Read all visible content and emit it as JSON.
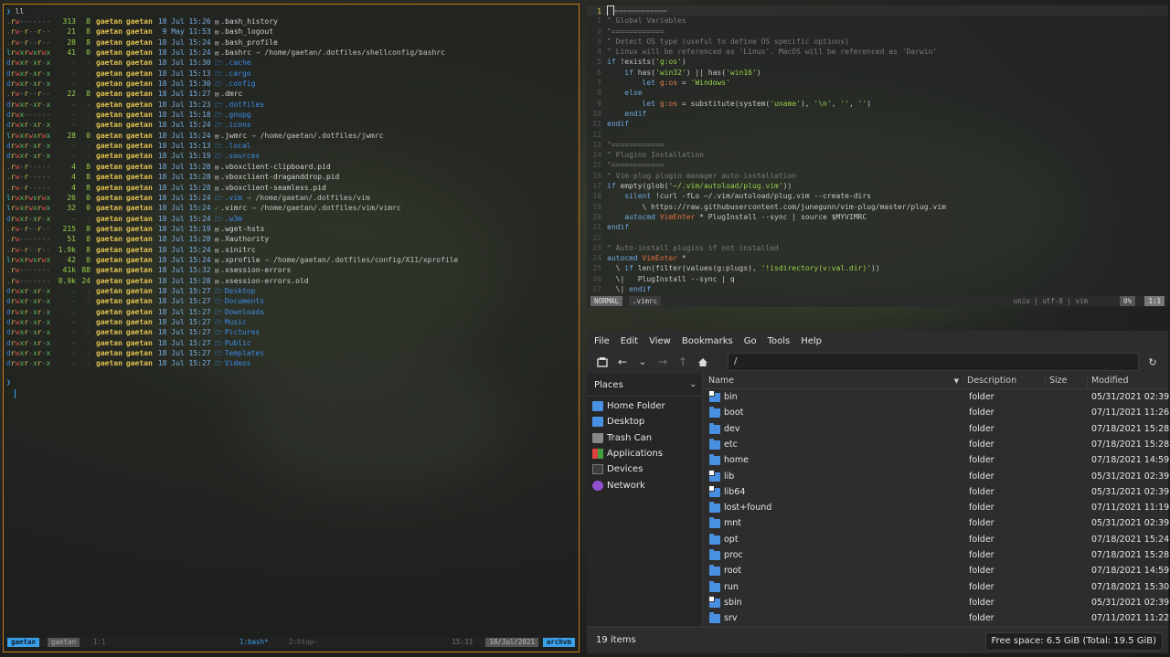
{
  "terminal": {
    "prompt_glyph": "❯",
    "command": "ll",
    "rows": [
      {
        "perm": ".rw-------",
        "size": "313",
        "blk": "8",
        "user": "gaetan",
        "group": "gaetan",
        "date": "18 Jul 15:26",
        "icon": "file",
        "name": ".bash_history",
        "link": ""
      },
      {
        "perm": ".rw-r--r--",
        "size": "21",
        "blk": "8",
        "user": "gaetan",
        "group": "gaetan",
        "date": " 9 May 11:53",
        "icon": "file",
        "name": ".bash_logout",
        "link": ""
      },
      {
        "perm": ".rw-r--r--",
        "size": "28",
        "blk": "8",
        "user": "gaetan",
        "group": "gaetan",
        "date": "18 Jul 15:24",
        "icon": "file",
        "name": ".bash_profile",
        "link": ""
      },
      {
        "perm": "lrwxrwxrwx",
        "size": "41",
        "blk": "0",
        "user": "gaetan",
        "group": "gaetan",
        "date": "18 Jul 15:24",
        "icon": "file",
        "name": ".bashrc",
        "link": "/home/gaetan/.dotfiles/shellconfig/bashrc"
      },
      {
        "perm": "drwxr-xr-x",
        "size": "-",
        "blk": "-",
        "user": "gaetan",
        "group": "gaetan",
        "date": "18 Jul 15:30",
        "icon": "dir",
        "name": ".cache",
        "link": ""
      },
      {
        "perm": "drwxr-xr-x",
        "size": "-",
        "blk": "-",
        "user": "gaetan",
        "group": "gaetan",
        "date": "18 Jul 15:13",
        "icon": "dir",
        "name": ".cargo",
        "link": ""
      },
      {
        "perm": "drwxr-xr-x",
        "size": "-",
        "blk": "-",
        "user": "gaetan",
        "group": "gaetan",
        "date": "18 Jul 15:30",
        "icon": "dir",
        "name": ".config",
        "link": ""
      },
      {
        "perm": ".rw-r--r--",
        "size": "22",
        "blk": "8",
        "user": "gaetan",
        "group": "gaetan",
        "date": "18 Jul 15:27",
        "icon": "file",
        "name": ".dmrc",
        "link": ""
      },
      {
        "perm": "drwxr-xr-x",
        "size": "-",
        "blk": "-",
        "user": "gaetan",
        "group": "gaetan",
        "date": "18 Jul 15:23",
        "icon": "dir",
        "name": ".dotfiles",
        "link": ""
      },
      {
        "perm": "drwx------",
        "size": "-",
        "blk": "-",
        "user": "gaetan",
        "group": "gaetan",
        "date": "18 Jul 15:18",
        "icon": "dir",
        "name": ".gnupg",
        "link": ""
      },
      {
        "perm": "drwxr-xr-x",
        "size": "-",
        "blk": "-",
        "user": "gaetan",
        "group": "gaetan",
        "date": "18 Jul 15:24",
        "icon": "dir",
        "name": ".icons",
        "link": ""
      },
      {
        "perm": "lrwxrwxrwx",
        "size": "28",
        "blk": "0",
        "user": "gaetan",
        "group": "gaetan",
        "date": "18 Jul 15:24",
        "icon": "file",
        "name": ".jwmrc",
        "link": "/home/gaetan/.dotfiles/jwmrc"
      },
      {
        "perm": "drwxr-xr-x",
        "size": "-",
        "blk": "-",
        "user": "gaetan",
        "group": "gaetan",
        "date": "18 Jul 15:13",
        "icon": "dir",
        "name": ".local",
        "link": ""
      },
      {
        "perm": "drwxr-xr-x",
        "size": "-",
        "blk": "-",
        "user": "gaetan",
        "group": "gaetan",
        "date": "18 Jul 15:19",
        "icon": "dir",
        "name": ".sources",
        "link": ""
      },
      {
        "perm": ".rw-r-----",
        "size": "4",
        "blk": "8",
        "user": "gaetan",
        "group": "gaetan",
        "date": "18 Jul 15:28",
        "icon": "file",
        "name": ".vboxclient-clipboard.pid",
        "link": ""
      },
      {
        "perm": ".rw-r-----",
        "size": "4",
        "blk": "8",
        "user": "gaetan",
        "group": "gaetan",
        "date": "18 Jul 15:28",
        "icon": "file",
        "name": ".vboxclient-draganddrop.pid",
        "link": ""
      },
      {
        "perm": ".rw-r-----",
        "size": "4",
        "blk": "8",
        "user": "gaetan",
        "group": "gaetan",
        "date": "18 Jul 15:28",
        "icon": "file",
        "name": ".vboxclient-seamless.pid",
        "link": ""
      },
      {
        "perm": "lrwxrwxrwx",
        "size": "26",
        "blk": "0",
        "user": "gaetan",
        "group": "gaetan",
        "date": "18 Jul 15:24",
        "icon": "dir",
        "name": ".vim",
        "link": "/home/gaetan/.dotfiles/vim"
      },
      {
        "perm": "lrwxrwxrwx",
        "size": "32",
        "blk": "0",
        "user": "gaetan",
        "group": "gaetan",
        "date": "18 Jul 15:24",
        "icon": "vim",
        "name": ".vimrc",
        "link": "/home/gaetan/.dotfiles/vim/vimrc"
      },
      {
        "perm": "drwxr-xr-x",
        "size": "-",
        "blk": "-",
        "user": "gaetan",
        "group": "gaetan",
        "date": "18 Jul 15:24",
        "icon": "dir",
        "name": ".w3m",
        "link": ""
      },
      {
        "perm": ".rw-r--r--",
        "size": "215",
        "blk": "8",
        "user": "gaetan",
        "group": "gaetan",
        "date": "18 Jul 15:19",
        "icon": "file",
        "name": ".wget-hsts",
        "link": ""
      },
      {
        "perm": ".rw-------",
        "size": "51",
        "blk": "8",
        "user": "gaetan",
        "group": "gaetan",
        "date": "18 Jul 15:28",
        "icon": "file",
        "name": ".Xauthority",
        "link": ""
      },
      {
        "perm": ".rw-r--r--",
        "size": "1.9k",
        "blk": "8",
        "user": "gaetan",
        "group": "gaetan",
        "date": "18 Jul 15:24",
        "icon": "file",
        "name": ".xinitrc",
        "link": ""
      },
      {
        "perm": "lrwxrwxrwx",
        "size": "42",
        "blk": "0",
        "user": "gaetan",
        "group": "gaetan",
        "date": "18 Jul 15:24",
        "icon": "file",
        "name": ".xprofile",
        "link": "/home/gaetan/.dotfiles/config/X11/xprofile"
      },
      {
        "perm": ".rw-------",
        "size": "41k",
        "blk": "88",
        "user": "gaetan",
        "group": "gaetan",
        "date": "18 Jul 15:32",
        "icon": "file",
        "name": ".xsession-errors",
        "link": ""
      },
      {
        "perm": ".rw-------",
        "size": "8.9k",
        "blk": "24",
        "user": "gaetan",
        "group": "gaetan",
        "date": "18 Jul 15:28",
        "icon": "file",
        "name": ".xsession-errors.old",
        "link": ""
      },
      {
        "perm": "drwxr-xr-x",
        "size": "-",
        "blk": "-",
        "user": "gaetan",
        "group": "gaetan",
        "date": "18 Jul 15:27",
        "icon": "dir",
        "name": "Desktop",
        "link": ""
      },
      {
        "perm": "drwxr-xr-x",
        "size": "-",
        "blk": "-",
        "user": "gaetan",
        "group": "gaetan",
        "date": "18 Jul 15:27",
        "icon": "dir",
        "name": "Documents",
        "link": ""
      },
      {
        "perm": "drwxr-xr-x",
        "size": "-",
        "blk": "-",
        "user": "gaetan",
        "group": "gaetan",
        "date": "18 Jul 15:27",
        "icon": "dir",
        "name": "Downloads",
        "link": ""
      },
      {
        "perm": "drwxr-xr-x",
        "size": "-",
        "blk": "-",
        "user": "gaetan",
        "group": "gaetan",
        "date": "18 Jul 15:27",
        "icon": "dir",
        "name": "Music",
        "link": ""
      },
      {
        "perm": "drwxr-xr-x",
        "size": "-",
        "blk": "-",
        "user": "gaetan",
        "group": "gaetan",
        "date": "18 Jul 15:27",
        "icon": "dir",
        "name": "Pictures",
        "link": ""
      },
      {
        "perm": "drwxr-xr-x",
        "size": "-",
        "blk": "-",
        "user": "gaetan",
        "group": "gaetan",
        "date": "18 Jul 15:27",
        "icon": "dir",
        "name": "Public",
        "link": ""
      },
      {
        "perm": "drwxr-xr-x",
        "size": "-",
        "blk": "-",
        "user": "gaetan",
        "group": "gaetan",
        "date": "18 Jul 15:27",
        "icon": "dir",
        "name": "Templates",
        "link": ""
      },
      {
        "perm": "drwxr-xr-x",
        "size": "-",
        "blk": "-",
        "user": "gaetan",
        "group": "gaetan",
        "date": "18 Jul 15:27",
        "icon": "dir",
        "name": "Videos",
        "link": ""
      }
    ],
    "status": {
      "session": "gaetan",
      "session2": "gaetan",
      "pane": "1:1",
      "window1": "1:bash*",
      "window2": "2:htop-",
      "time": "15:33",
      "date": "18/Jul/2021",
      "host": "archvm"
    }
  },
  "vim": {
    "lines": [
      "\"============",
      "\" Global Variables",
      "\"============",
      "\" Detect OS type (useful to define OS specific options)",
      "\" Linux will be referenced as 'Linux'. MacOS will be referenced as 'Darwin'",
      "if !exists('g:os')",
      "    if has('win32') || has('win16')",
      "        let g:os = 'Windows'",
      "    else",
      "        let g:os = substitute(system('uname'), '\\n', '', '')",
      "    endif",
      "endif",
      "",
      "\"============",
      "\" Plugins Installation",
      "\"============",
      "\" Vim-plug plugin manager auto-installation",
      "if empty(glob('~/.vim/autoload/plug.vim'))",
      "    silent !curl -fLo ~/.vim/autoload/plug.vim --create-dirs",
      "        \\ https://raw.githubusercontent.com/junegunn/vim-plug/master/plug.vim",
      "    autocmd VimEnter * PlugInstall --sync | source $MYVIMRC",
      "endif",
      "",
      "\" Auto-install plugins if not installed",
      "autocmd VimEnter *",
      "  \\ if len(filter(values(g:plugs), '!isdirectory(v:val.dir)'))",
      "  \\|   PlugInstall --sync | q",
      "  \\| endif"
    ],
    "status": {
      "mode": "NORMAL",
      "file": ".vimrc",
      "info": "unix  |  utf-8  |  vim",
      "percent": "0%",
      "position": "1:1"
    }
  },
  "filemanager": {
    "menu": [
      "File",
      "Edit",
      "View",
      "Bookmarks",
      "Go",
      "Tools",
      "Help"
    ],
    "location": "/",
    "places_title": "Places",
    "places": [
      {
        "label": "Home Folder",
        "icon": "home-folder-icon",
        "color": "#4a90e2"
      },
      {
        "label": "Desktop",
        "icon": "desktop-icon",
        "color": "#4a90e2"
      },
      {
        "label": "Trash Can",
        "icon": "trash-icon",
        "color": "#888888"
      },
      {
        "label": "Applications",
        "icon": "applications-icon",
        "color": "#e04040"
      },
      {
        "label": "Devices",
        "icon": "devices-icon",
        "color": "#3c3c3c"
      },
      {
        "label": "Network",
        "icon": "network-icon",
        "color": "#9050d0"
      }
    ],
    "columns": [
      "Name",
      "Description",
      "Size",
      "Modified"
    ],
    "files": [
      {
        "name": "bin",
        "desc": "folder",
        "size": "",
        "modified": "05/31/2021 02:39",
        "link": true
      },
      {
        "name": "boot",
        "desc": "folder",
        "size": "",
        "modified": "07/11/2021 11:26",
        "link": false
      },
      {
        "name": "dev",
        "desc": "folder",
        "size": "",
        "modified": "07/18/2021 15:28",
        "link": false
      },
      {
        "name": "etc",
        "desc": "folder",
        "size": "",
        "modified": "07/18/2021 15:28",
        "link": false
      },
      {
        "name": "home",
        "desc": "folder",
        "size": "",
        "modified": "07/18/2021 14:59",
        "link": false
      },
      {
        "name": "lib",
        "desc": "folder",
        "size": "",
        "modified": "05/31/2021 02:39",
        "link": true
      },
      {
        "name": "lib64",
        "desc": "folder",
        "size": "",
        "modified": "05/31/2021 02:39",
        "link": true
      },
      {
        "name": "lost+found",
        "desc": "folder",
        "size": "",
        "modified": "07/11/2021 11:19",
        "link": false
      },
      {
        "name": "mnt",
        "desc": "folder",
        "size": "",
        "modified": "05/31/2021 02:39",
        "link": false
      },
      {
        "name": "opt",
        "desc": "folder",
        "size": "",
        "modified": "07/18/2021 15:24",
        "link": false
      },
      {
        "name": "proc",
        "desc": "folder",
        "size": "",
        "modified": "07/18/2021 15:28",
        "link": false
      },
      {
        "name": "root",
        "desc": "folder",
        "size": "",
        "modified": "07/18/2021 14:59",
        "link": false
      },
      {
        "name": "run",
        "desc": "folder",
        "size": "",
        "modified": "07/18/2021 15:30",
        "link": false
      },
      {
        "name": "sbin",
        "desc": "folder",
        "size": "",
        "modified": "05/31/2021 02:39",
        "link": true
      },
      {
        "name": "srv",
        "desc": "folder",
        "size": "",
        "modified": "07/11/2021 11:22",
        "link": false
      }
    ],
    "item_count": "19 items",
    "free_space": "Free space: 6.5 GiB (Total: 19.5 GiB)"
  },
  "colors": {
    "accent": "#3aa0e8",
    "terminal_border": "#c47a18",
    "folder": "#4a90e2"
  }
}
